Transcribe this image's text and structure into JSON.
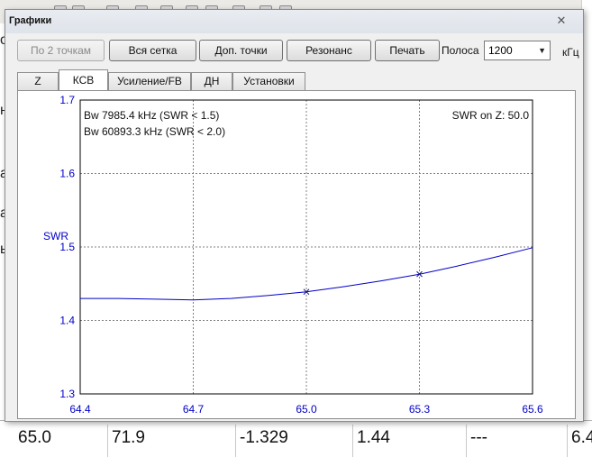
{
  "background": {
    "left_fragments": [
      "ор",
      "на",
      "аб",
      "ал",
      "ы"
    ],
    "table_row": [
      "65.0",
      "71.9",
      "-1.329",
      "1.44",
      "---",
      "6.4"
    ]
  },
  "dialog": {
    "title": "Графики",
    "close_glyph": "✕"
  },
  "toolbar": {
    "btn_by2points": "По 2 точкам",
    "btn_fullgrid": "Вся сетка",
    "btn_extra_points": "Доп. точки",
    "btn_resonance": "Резонанс",
    "btn_print": "Печать",
    "band_label": "Полоса",
    "band_value": "1200",
    "band_unit": "кГц"
  },
  "tabs": [
    {
      "label": "Z",
      "active": false
    },
    {
      "label": "КСВ",
      "active": true
    },
    {
      "label": "Усиление/FB",
      "active": false
    },
    {
      "label": "ДН",
      "active": false
    },
    {
      "label": "Установки",
      "active": false
    }
  ],
  "colors": {
    "axis_text": "#0000c8",
    "series": "#0000c8",
    "grid": "#808080"
  },
  "chart_data": {
    "type": "line",
    "ylabel": "SWR",
    "xlim": [
      64.4,
      65.6
    ],
    "ylim": [
      1.3,
      1.7
    ],
    "xticks": [
      "64.4",
      "64.7",
      "65.0",
      "65.3",
      "65.6"
    ],
    "yticks": [
      "1.3",
      "1.4",
      "1.5",
      "1.6",
      "1.7"
    ],
    "grid": true,
    "annotations": [
      "Bw 7985.4 kHz (SWR < 1.5)",
      "Bw 60893.3 kHz (SWR < 2.0)",
      "SWR on Z: 50.0"
    ],
    "series": [
      {
        "x": [
          64.4,
          64.5,
          64.6,
          64.7,
          64.8,
          64.9,
          65.0,
          65.1,
          65.2,
          65.3,
          65.4,
          65.5,
          65.6
        ],
        "y": [
          1.43,
          1.43,
          1.429,
          1.428,
          1.43,
          1.434,
          1.439,
          1.446,
          1.454,
          1.463,
          1.474,
          1.486,
          1.499
        ]
      }
    ],
    "markers_x": [
      65.0,
      65.3
    ]
  }
}
